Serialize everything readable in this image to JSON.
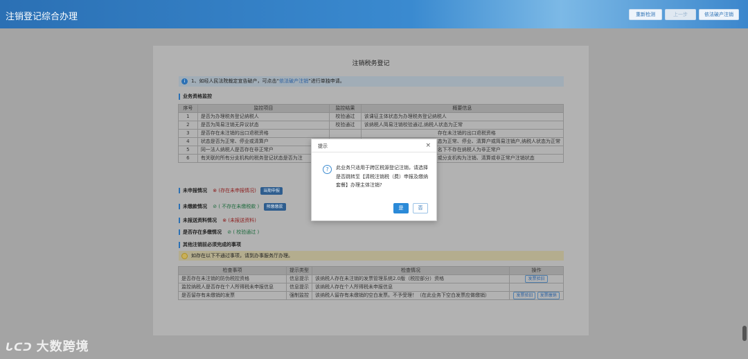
{
  "app": {
    "title": "注销登记综合办理",
    "buttons": [
      "重新检测",
      "上一步",
      "依法破产注销"
    ]
  },
  "panel": {
    "title": "注销税务登记",
    "notice": {
      "prefix": "1、如经人民法院裁定宣告破产，可点击“",
      "link": "依法破产注销",
      "suffix": "”进行单独申请。"
    },
    "business_section": "业务资格监控",
    "table1": {
      "headers": [
        "序号",
        "监控项目",
        "监控结果",
        "概要信息"
      ],
      "rows": [
        {
          "no": "1",
          "item": "是否为办理税务登记纳税人",
          "result": "校验通过",
          "summary": "该课征主体状态为办理税务登记纳税人"
        },
        {
          "no": "2",
          "item": "是否为简易注销无异议状态",
          "result": "校验通过",
          "summary": "该纳税人简易注销校验通过,纳税人状态为正常"
        },
        {
          "no": "3",
          "item": "是否存在未注销的出口退税资格",
          "result": "",
          "summary": "存在未注销的出口退税资格"
        },
        {
          "no": "4",
          "item": "状态是否为正常、停业或清算户",
          "result": "",
          "summary": "态为正常、停业、清算户或简易注销户,纳税人状态为正常"
        },
        {
          "no": "5",
          "item": "同一法人纳税人是否存在非正常户",
          "result": "",
          "summary": "名下不存在纳税人为非正常户"
        },
        {
          "no": "6",
          "item": "有关联的所有分支机构的税务登记状态是否为注",
          "result": "",
          "summary": "或分支机构为注销、清算或非正常户注销状态"
        }
      ]
    },
    "lines": {
      "unfiled": {
        "label": "未申报情况",
        "status": "(存在未申报情况)",
        "button": "当期申报"
      },
      "unpaid": {
        "label": "未缴款情况",
        "status": "( 不存在未缴税款 )",
        "button": "预缴缴款"
      },
      "unsubmitted": {
        "label": "未报送资料情况",
        "status": "(未报送资料)"
      },
      "multiple": {
        "label": "是否存在多缴情况",
        "status": "( 校验通过 )"
      }
    },
    "other_section": "其他注销前必须完成的事项",
    "hint": "如存在以下不通过事项，请到办事服务厅办理。",
    "table2": {
      "headers": [
        "检查事项",
        "提示类型",
        "检查情况",
        "操作"
      ],
      "rows": [
        {
          "item": "是否存在未注销的防伪税控资格",
          "type": "信息提示",
          "detail": "该纳税人存在未注销的发票管理系统2.0版（税控部分）资格",
          "ops": [
            "发票验旧"
          ]
        },
        {
          "item": "监控纳税人是否存在个人所得税未申报信息",
          "type": "信息提示",
          "detail": "该纳税人存在个人所得税未申报信息",
          "ops": []
        },
        {
          "item": "是否留存有未缴销的发票",
          "type": "强制监控",
          "detail": "该纳税人留存有未缴销的空白发票。不予受理！（在此业务下空白发票应做缴销）",
          "ops": [
            "发票验旧",
            "发票缴销"
          ]
        }
      ]
    }
  },
  "dialog": {
    "title": "提示",
    "close": "×",
    "message": "此业务只适用于跨区税源登记注销，请选择是否跳转至【清税注销税（费）申报及缴纳套餐】办理主体注销?",
    "yes": "是",
    "no": "否"
  },
  "watermark": {
    "logo": "ᒐᑕᑐ",
    "text": "大数跨境"
  }
}
